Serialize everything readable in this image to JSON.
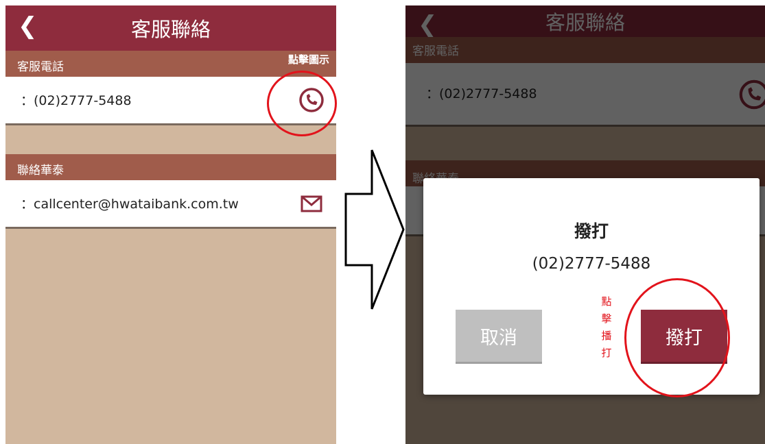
{
  "header": {
    "back_glyph": "❮",
    "title": "客服聯絡"
  },
  "phone_section": {
    "label": "客服電話",
    "hint": "點擊圖示",
    "value": "：(02)2777-5488",
    "icon": "phone-icon"
  },
  "contact_section": {
    "label": "聯絡華泰",
    "value": "：callcenter@hwataibank.com.tw",
    "icon": "mail-icon"
  },
  "dialog": {
    "title": "撥打",
    "message": "(02)2777-5488",
    "cancel_label": "取消",
    "call_label": "撥打",
    "side_hint": "點擊播打"
  },
  "colors": {
    "brand": "#8e2c3d",
    "section": "#a05c4b",
    "background": "#d1b79e",
    "annotation": "#e2131b"
  }
}
